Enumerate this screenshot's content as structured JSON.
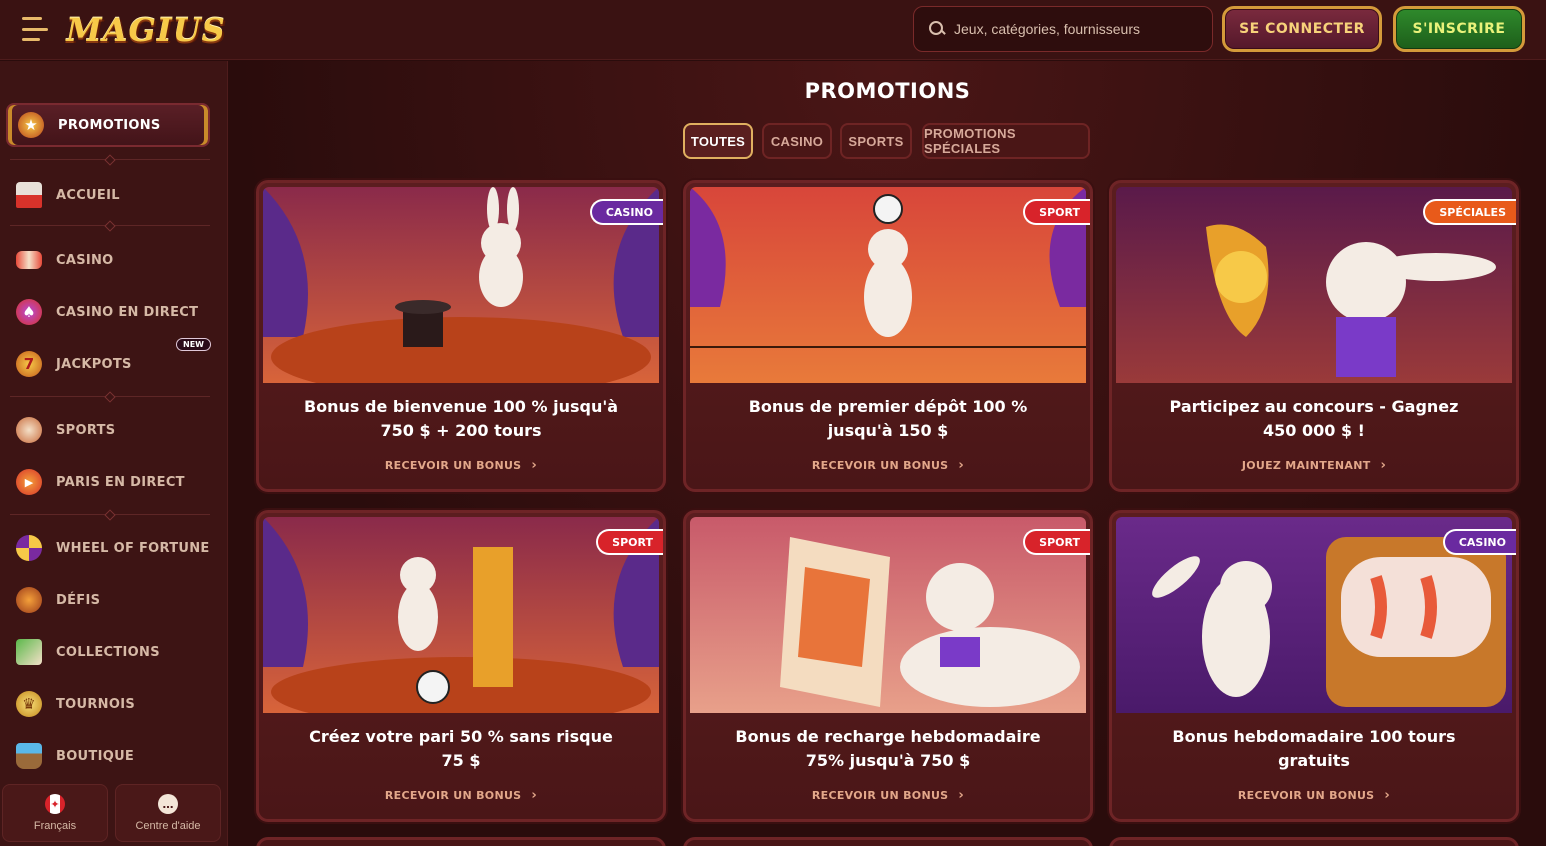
{
  "header": {
    "logo": "MAGIUS",
    "search_placeholder": "Jeux, catégories, fournisseurs",
    "login_label": "SE CONNECTER",
    "register_label": "S'INSCRIRE"
  },
  "sidebar": {
    "items": [
      {
        "label": "Promotions",
        "icon": "gift-star-icon",
        "active": true
      },
      {
        "label": "Accueil",
        "icon": "circus-tent-icon"
      },
      {
        "label": "Casino",
        "icon": "slot-reels-icon"
      },
      {
        "label": "Casino en direct",
        "icon": "live-casino-icon"
      },
      {
        "label": "Jackpots",
        "icon": "jackpot-seven-icon",
        "badge": "NEW"
      },
      {
        "label": "Sports",
        "icon": "sports-trophy-icon"
      },
      {
        "label": "Paris en direct",
        "icon": "live-betting-icon"
      },
      {
        "label": "Wheel of fortune",
        "icon": "fortune-wheel-icon"
      },
      {
        "label": "Défis",
        "icon": "challenge-medal-icon"
      },
      {
        "label": "Collections",
        "icon": "cards-collection-icon"
      },
      {
        "label": "Tournois",
        "icon": "tournament-trophy-icon"
      },
      {
        "label": "Boutique",
        "icon": "shop-basket-icon"
      }
    ],
    "language_label": "Français",
    "help_label": "Centre d'aide"
  },
  "main": {
    "title": "Promotions",
    "tabs": [
      {
        "label": "TOUTES",
        "active": true
      },
      {
        "label": "CASINO"
      },
      {
        "label": "SPORTS"
      },
      {
        "label": "PROMOTIONS SPÉCIALES"
      }
    ],
    "cards": [
      {
        "tag": "CASINO",
        "title_line1": "Bonus de bienvenue 100 % jusqu'à",
        "title_line2": "750 $ + 200 tours",
        "link": "RECEVOIR UN BONUS"
      },
      {
        "tag": "SPORT",
        "title_line1": "Bonus de premier dépôt 100 %",
        "title_line2": "jusqu'à 150 $",
        "link": "RECEVOIR UN BONUS"
      },
      {
        "tag": "SPÉCIALES",
        "title_line1": "Participez au concours - Gagnez",
        "title_line2": "450 000 $ !",
        "link": "JOUEZ MAINTENANT"
      },
      {
        "tag": "SPORT",
        "title_line1": "Créez votre pari 50 % sans risque",
        "title_line2": "75 $",
        "link": "RECEVOIR UN BONUS"
      },
      {
        "tag": "SPORT",
        "title_line1": "Bonus de recharge hebdomadaire",
        "title_line2": "75% jusqu'à 750 $",
        "link": "RECEVOIR UN BONUS"
      },
      {
        "tag": "CASINO",
        "title_line1": "Bonus hebdomadaire 100 tours",
        "title_line2": "gratuits",
        "link": "RECEVOIR UN BONUS"
      }
    ]
  },
  "colors": {
    "background": "#2a0c0c",
    "header": "#3a1212",
    "sidebar": "#3d1414",
    "card": "#5b1d1f",
    "accent_gold": "#d49a3a",
    "register_green": "#2f8a2c",
    "tag_casino": "#6a2aa0",
    "tag_sport": "#d8232a",
    "tag_special": "#e85a1a"
  }
}
